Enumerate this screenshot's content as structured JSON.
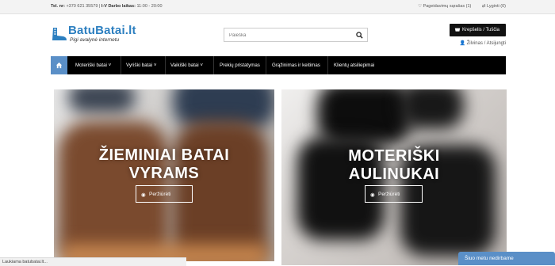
{
  "topbar": {
    "phone_label": "Tel. nr:",
    "phone": "+370 621 35579",
    "hours_label": "I-V Darbo laikas:",
    "hours": "11:00 - 20:00",
    "wishlist": "Pageidavimų sąrašas (1)",
    "compare": "Lyginti (0)"
  },
  "logo": {
    "name": "BatuBatai.lt",
    "tagline": "Pigi avalynė internetu"
  },
  "search": {
    "placeholder": "Paieška"
  },
  "cart": {
    "label": "Krepšelis / Tuščia"
  },
  "account": {
    "links": "Žilvinas / Atsijungti"
  },
  "nav": {
    "items": [
      "Moteriški batai",
      "Vyriški batai",
      "Vaikiški batai",
      "Prekių pristatymas",
      "Grąžinimas ir keitimas",
      "Klientų atsiliepimai"
    ]
  },
  "banners": [
    {
      "title_line1": "ŽIEMINIAI BATAI",
      "title_line2": "VYRAMS",
      "button": "Peržiūrėti"
    },
    {
      "title_line1": "MOTERIŠKI",
      "title_line2": "AULINUKAI",
      "button": "Peržiūrėti"
    }
  ],
  "status": "Laukiama batubatai.lt...",
  "chat": {
    "label": "Šiuo metu nedirbame"
  },
  "colors": {
    "accent": "#5a8fc7",
    "nav_bg": "#000000",
    "cart_bg": "#111111"
  },
  "icons": [
    "heart-icon",
    "compare-icon",
    "search-icon",
    "cart-icon",
    "user-icon",
    "home-icon",
    "chevron-down-icon",
    "eye-icon"
  ]
}
